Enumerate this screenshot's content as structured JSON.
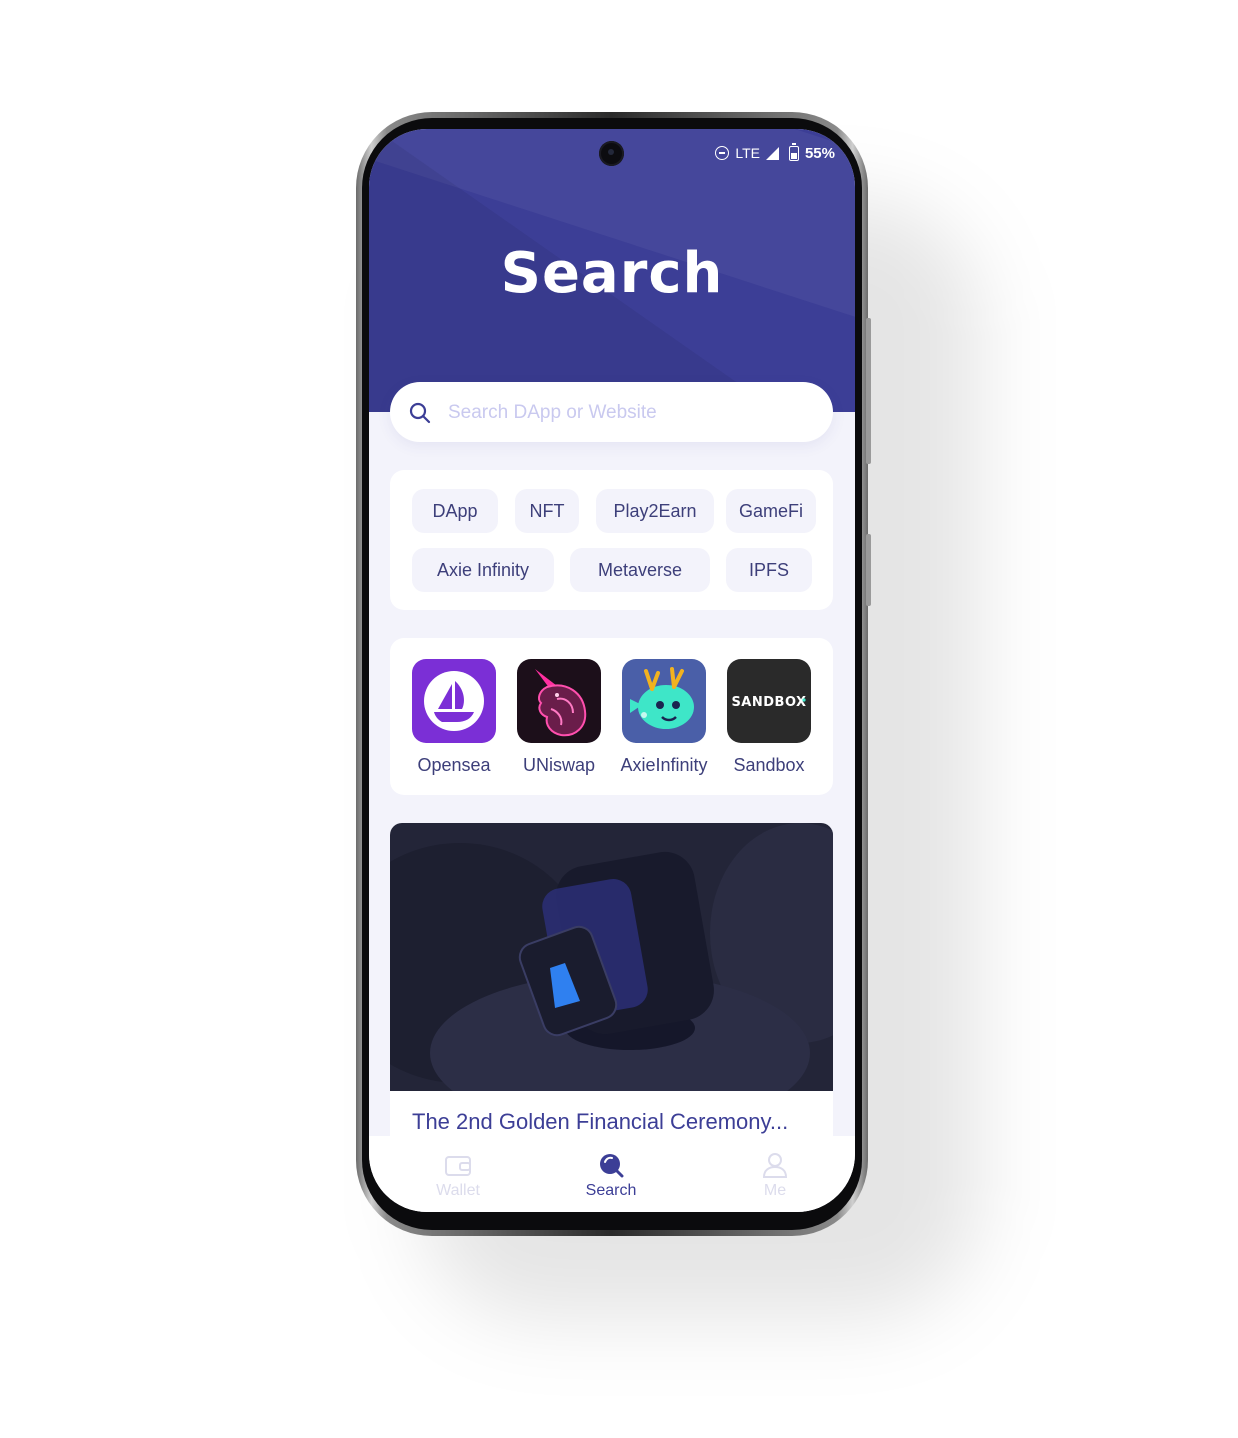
{
  "status_bar": {
    "network": "LTE",
    "battery": "55%"
  },
  "header": {
    "title": "Search"
  },
  "search": {
    "placeholder": "Search DApp or Website",
    "icon": "search-icon"
  },
  "tags": [
    "DApp",
    "NFT",
    "Play2Earn",
    "GameFi",
    "Axie Infinity",
    "Metaverse",
    "IPFS"
  ],
  "apps": [
    {
      "label": "Opensea",
      "icon": "opensea-logo",
      "color": "#7b2fd6"
    },
    {
      "label": "UNiswap",
      "icon": "uniswap-logo",
      "color": "#1c0f1a"
    },
    {
      "label": "AxieInfinity",
      "icon": "axie-infinity-logo",
      "color": "#4a5fa8"
    },
    {
      "label": "Sandbox",
      "icon": "sandbox-logo",
      "color": "#2a2a2a"
    }
  ],
  "sandbox_logo_text": "SANDBOX",
  "news": {
    "title": "The 2nd Golden Financial Ceremony..."
  },
  "tabbar": [
    {
      "label": "Wallet",
      "icon": "wallet-icon",
      "active": false
    },
    {
      "label": "Search",
      "icon": "search-tab-icon",
      "active": true
    },
    {
      "label": "Me",
      "icon": "user-icon",
      "active": false
    }
  ],
  "colors": {
    "primary": "#3c3e96",
    "background": "#f3f3fb",
    "placeholder": "#c9c9ef",
    "inactive_tab": "#dcdcec"
  }
}
